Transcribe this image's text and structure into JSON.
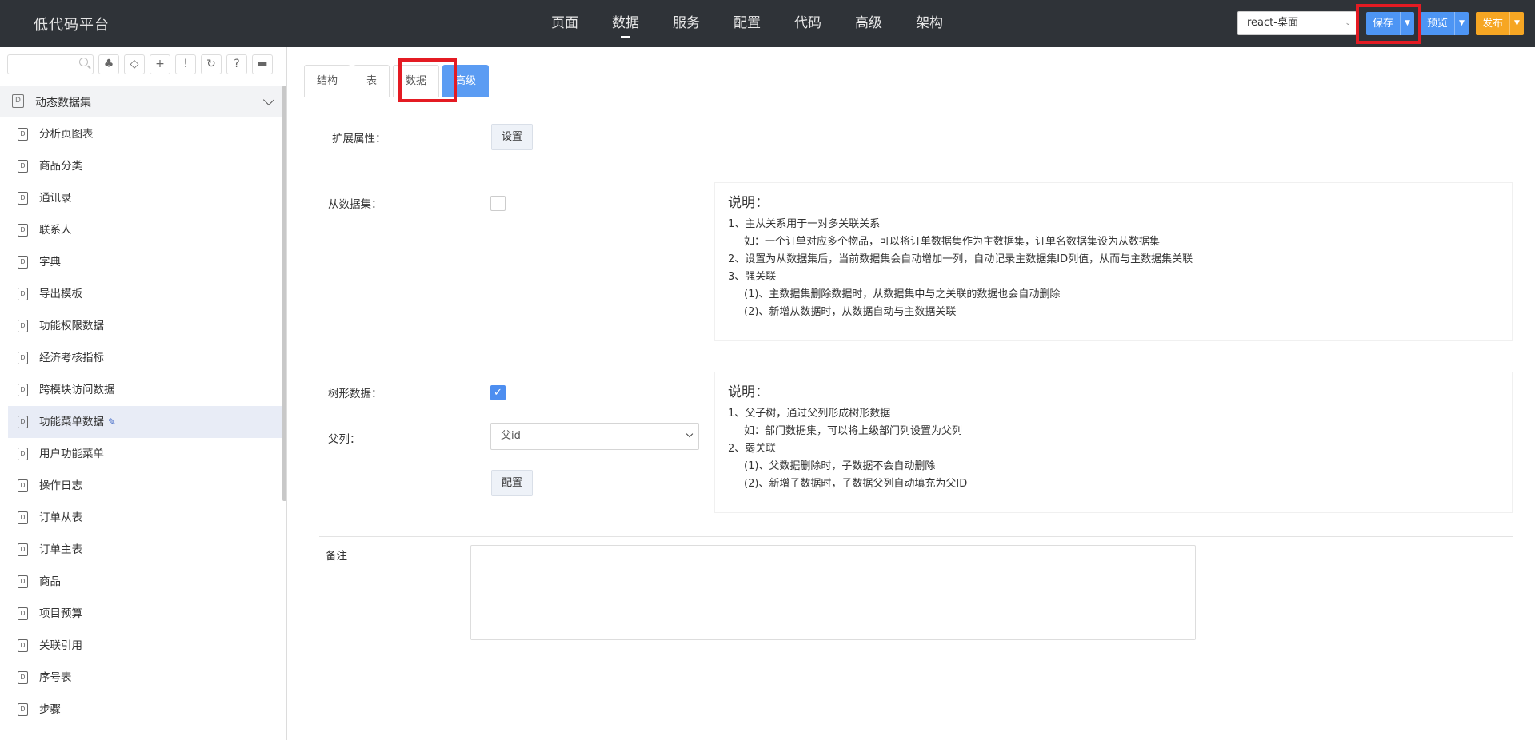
{
  "header": {
    "brand": "低代码平台",
    "nav": [
      "页面",
      "数据",
      "服务",
      "配置",
      "代码",
      "高级",
      "架构"
    ],
    "active_nav": "数据",
    "env_select": "react-桌面",
    "save_label": "保存",
    "preview_label": "预览",
    "publish_label": "发布",
    "colors": {
      "bar": "#2f3338",
      "primary": "#4d95f4",
      "publish": "#f6a623",
      "highlight": "#e41b23"
    }
  },
  "sidebar": {
    "search_placeholder": "",
    "tools": [
      "tree-icon",
      "tag-icon",
      "plus-icon",
      "exclamation-icon",
      "refresh-icon",
      "question-icon",
      "folder-icon"
    ],
    "tool_glyphs": [
      "♣",
      "◇",
      "+",
      "!",
      "↻",
      "?",
      "▬"
    ],
    "group_label": "动态数据集",
    "items": [
      {
        "label": "分析页图表"
      },
      {
        "label": "商品分类"
      },
      {
        "label": "通讯录"
      },
      {
        "label": "联系人"
      },
      {
        "label": "字典"
      },
      {
        "label": "导出模板"
      },
      {
        "label": "功能权限数据"
      },
      {
        "label": "经济考核指标"
      },
      {
        "label": "跨模块访问数据"
      },
      {
        "label": "功能菜单数据"
      },
      {
        "label": "用户功能菜单"
      },
      {
        "label": "操作日志"
      },
      {
        "label": "订单从表"
      },
      {
        "label": "订单主表"
      },
      {
        "label": "商品"
      },
      {
        "label": "项目预算"
      },
      {
        "label": "关联引用"
      },
      {
        "label": "序号表"
      },
      {
        "label": "步骤"
      }
    ],
    "active_index": 9,
    "icon_letter": "D"
  },
  "tabs": [
    "结构",
    "表",
    "数据",
    "高级"
  ],
  "selected_tab": "高级",
  "form": {
    "ext_label": "扩展属性：",
    "ext_button": "设置",
    "sub_label": "从数据集：",
    "sub_checked": false,
    "tree_label": "树形数据：",
    "tree_checked": true,
    "check_glyph": "✓",
    "parent_label": "父列：",
    "parent_value": "父id",
    "config_button": "配置",
    "remark_label": "备注",
    "remark_value": ""
  },
  "note1": {
    "title": "说明：",
    "lines": [
      {
        "text": "1、主从关系用于一对多关联关系",
        "indent": false
      },
      {
        "text": "如：一个订单对应多个物品，可以将订单数据集作为主数据集，订单名数据集设为从数据集",
        "indent": true
      },
      {
        "text": "2、设置为从数据集后，当前数据集会自动增加一列，自动记录主数据集ID列值，从而与主数据集关联",
        "indent": false
      },
      {
        "text": "3、强关联",
        "indent": false
      },
      {
        "text": "(1)、主数据集删除数据时，从数据集中与之关联的数据也会自动删除",
        "indent": true
      },
      {
        "text": "(2)、新增从数据时，从数据自动与主数据关联",
        "indent": true
      }
    ]
  },
  "note2": {
    "title": "说明：",
    "lines": [
      {
        "text": "1、父子树，通过父列形成树形数据",
        "indent": false
      },
      {
        "text": "如：部门数据集，可以将上级部门列设置为父列",
        "indent": true
      },
      {
        "text": "2、弱关联",
        "indent": false
      },
      {
        "text": "(1)、父数据删除时，子数据不会自动删除",
        "indent": true
      },
      {
        "text": "(2)、新增子数据时，子数据父列自动填充为父ID",
        "indent": true
      }
    ]
  }
}
